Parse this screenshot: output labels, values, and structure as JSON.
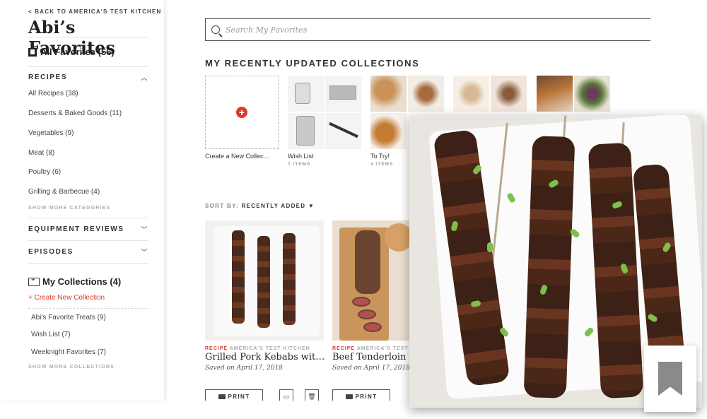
{
  "sidebar": {
    "back_link": "< Back to America's Test Kitchen",
    "title": "Abi’s Favorites",
    "all_favorites": "All Favorites (56)",
    "recipes_header": "RECIPES",
    "recipe_categories": [
      "All Recipes (38)",
      "Desserts & Baked Goods (11)",
      "Vegetables (9)",
      "Meat (8)",
      "Poultry (6)",
      "Grilling & Barbecue (4)"
    ],
    "show_more_categories": "Show more categories",
    "equipment_header": "EQUIPMENT REVIEWS",
    "episodes_header": "EPISODES",
    "my_collections": "My Collections (4)",
    "create_collection": "+ Create New Collection",
    "collections": [
      "Abi's Favorite Treats (9)",
      "Wish List (7)",
      "Weeknight Favorites (7)"
    ],
    "show_more_collections": "Show more collections"
  },
  "search": {
    "placeholder": "Search My Favorites"
  },
  "recent": {
    "title": "MY RECENTLY UPDATED COLLECTIONS",
    "create_label": "Create a New Collec…",
    "collections": [
      {
        "label": "Wish List",
        "count": "7 ITEMS"
      },
      {
        "label": "To Try!",
        "count": "4 ITEMS"
      }
    ]
  },
  "sort": {
    "label": "SORT BY:",
    "value": "RECENTLY ADDED ▼"
  },
  "cards": [
    {
      "type": "RECIPE",
      "source": "AMERICA'S TEST KITCHEN",
      "title": "Grilled Pork Kebabs wit…",
      "date": "Saved on April 17, 2018",
      "print": "PRINT"
    },
    {
      "type": "RECIPE",
      "source": "AMERICA'S TEST",
      "title": "Beef Tenderloin w",
      "date": "Saved on April 17, 2018",
      "print": "PRINT"
    }
  ],
  "icons": {
    "search": "search-icon",
    "bookmark": "bookmark-icon",
    "folder": "folder-plus-icon",
    "printer": "printer-icon",
    "trash": "trash-icon"
  },
  "colors": {
    "accent": "#d73a2c",
    "bookmark": "#8a8a8a"
  }
}
